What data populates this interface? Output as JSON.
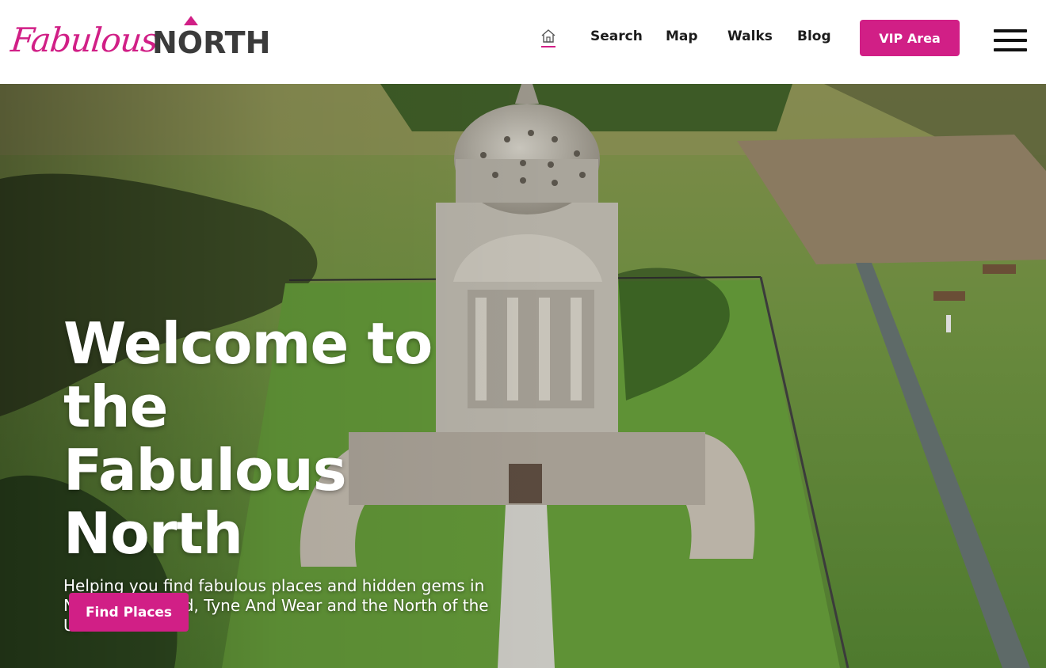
{
  "brand": {
    "logo_script": "Fabulous",
    "logo_bold": "NORTH",
    "accent_color": "#d11f86",
    "text_color": "#3b3b3b"
  },
  "nav": {
    "home_icon": "home-icon",
    "links": [
      "Search",
      "Map",
      "Walks",
      "Blog"
    ],
    "vip_label": "VIP Area",
    "menu_icon": "hamburger-menu-icon"
  },
  "hero": {
    "title": "Welcome to the Fabulous North",
    "subtitle": "Helping you find fabulous places and hidden gems in Northumberland, Tyne And Wear and the North of the UK.",
    "cta_label": "Find Places"
  }
}
